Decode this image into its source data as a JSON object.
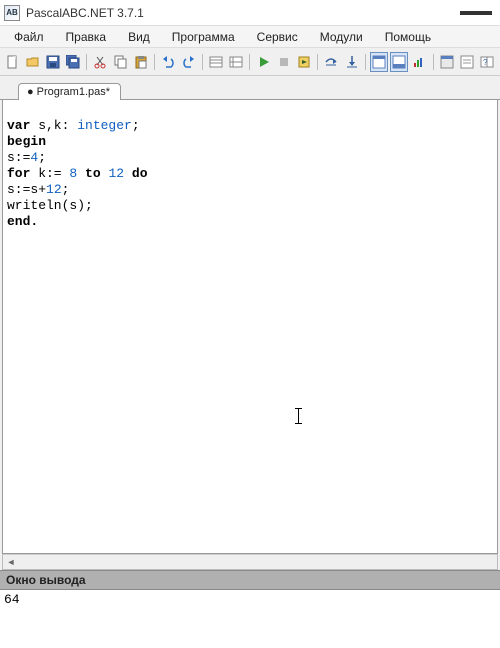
{
  "window": {
    "title": "PascalABC.NET 3.7.1",
    "app_icon_text": "AB"
  },
  "menu": {
    "file": "Файл",
    "edit": "Правка",
    "view": "Вид",
    "program": "Программа",
    "service": "Сервис",
    "modules": "Модули",
    "help": "Помощь"
  },
  "tab": {
    "modified_marker": "●",
    "name": "Program1.pas*"
  },
  "code": {
    "l1_var": "var",
    "l1_ids": " s,k: ",
    "l1_type": "integer",
    "l1_semi": ";",
    "l2": "begin",
    "l3a": "s:=",
    "l3n": "4",
    "l3b": ";",
    "l4a": "for",
    "l4b": " k:= ",
    "l4n1": "8",
    "l4c": " ",
    "l4to": "to",
    "l4d": " ",
    "l4n2": "12",
    "l4e": " ",
    "l4do": "do",
    "l5a": "s:=s+",
    "l5n": "12",
    "l5b": ";",
    "l6": "writeln(s);",
    "l7": "end."
  },
  "output": {
    "header": "Окно вывода",
    "text": "64"
  },
  "icons": {
    "new": "new-file-icon",
    "open": "open-folder-icon",
    "save": "save-icon",
    "saveall": "save-all-icon",
    "cut": "cut-icon",
    "copy": "copy-icon",
    "paste": "paste-icon",
    "undo": "undo-icon",
    "redo": "redo-icon",
    "props1": "properties-icon",
    "props2": "properties2-icon",
    "run": "run-icon",
    "stop": "stop-icon",
    "compile": "compile-icon",
    "stepover": "step-over-icon",
    "stepin": "step-in-icon",
    "panel1": "panel1-icon",
    "panel2": "panel2-icon",
    "chart": "chart-icon",
    "form": "form-icon",
    "window": "window-icon",
    "help": "help-icon"
  }
}
